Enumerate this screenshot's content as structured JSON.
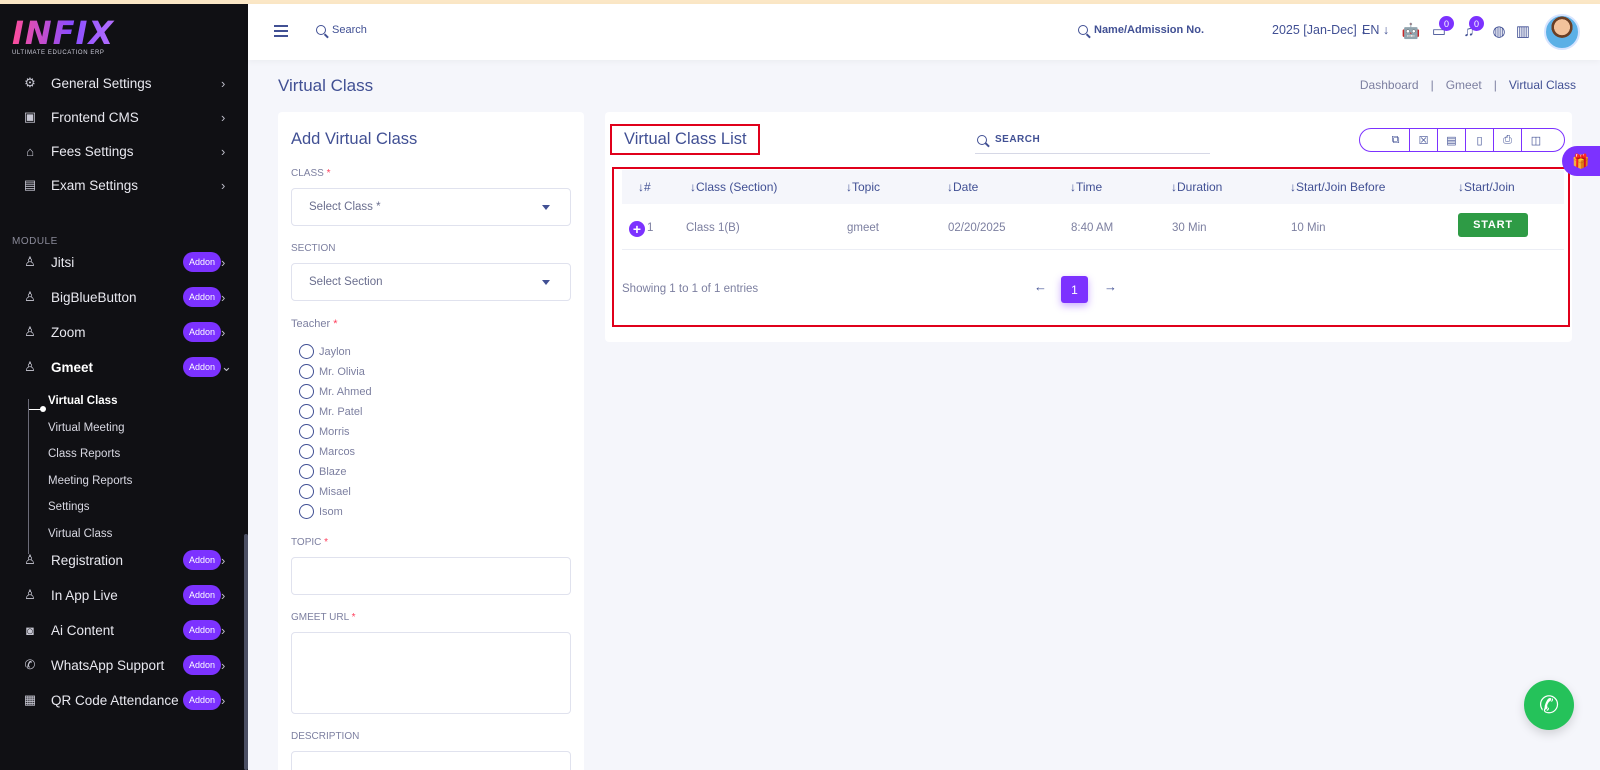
{
  "logo": {
    "text": "INFIX",
    "subtitle": "ULTIMATE EDUCATION ERP"
  },
  "sidebar": {
    "top_items": [
      {
        "label": "General Settings",
        "icon": "gears-icon"
      },
      {
        "label": "Frontend CMS",
        "icon": "desktop-icon"
      },
      {
        "label": "Fees Settings",
        "icon": "bank-icon"
      },
      {
        "label": "Exam Settings",
        "icon": "book-icon"
      }
    ],
    "module_heading": "MODULE",
    "modules": [
      {
        "label": "Jitsi",
        "badge": "Addon"
      },
      {
        "label": "BigBlueButton",
        "badge": "Addon"
      },
      {
        "label": "Zoom",
        "badge": "Addon"
      },
      {
        "label": "Gmeet",
        "badge": "Addon"
      }
    ],
    "gmeet_sub": [
      "Virtual Class",
      "Virtual Meeting",
      "Class Reports",
      "Meeting Reports",
      "Settings",
      "Virtual Class"
    ],
    "bottom_modules": [
      {
        "label": "Registration",
        "badge": "Addon"
      },
      {
        "label": "In App Live",
        "badge": "Addon"
      },
      {
        "label": "Ai Content",
        "badge": "Addon"
      },
      {
        "label": "WhatsApp Support",
        "badge": "Addon"
      },
      {
        "label": "QR Code Attendance",
        "badge": "Addon"
      }
    ]
  },
  "header": {
    "search": "Search",
    "name_search": "Name/Admission No.",
    "year": "2025 [Jan-Dec]",
    "lang": "EN",
    "chat_count": "0",
    "notif_count": "0"
  },
  "page": {
    "title": "Virtual Class",
    "breadcrumb": [
      "Dashboard",
      "Gmeet",
      "Virtual Class"
    ]
  },
  "form": {
    "title": "Add Virtual Class",
    "class_label": "CLASS",
    "class_placeholder": "Select Class *",
    "section_label": "SECTION",
    "section_placeholder": "Select Section",
    "teacher_label": "Teacher",
    "teachers": [
      "Jaylon",
      "Mr. Olivia",
      "Mr. Ahmed",
      "Mr. Patel",
      "Morris",
      "Marcos",
      "Blaze",
      "Misael",
      "Isom"
    ],
    "topic_label": "TOPIC",
    "url_label": "GMEET URL",
    "description_label": "DESCRIPTION",
    "required_mark": "*"
  },
  "list": {
    "title": "Virtual Class List",
    "search_placeholder": "SEARCH",
    "columns": [
      "#",
      "Class (Section)",
      "Topic",
      "Date",
      "Time",
      "Duration",
      "Start/Join Before",
      "Start/Join"
    ],
    "rows": [
      {
        "no": "1",
        "class": "Class 1(B)",
        "topic": "gmeet",
        "date": "02/20/2025",
        "time": "8:40 AM",
        "duration": "30 Min",
        "before": "10 Min",
        "action": "START"
      }
    ],
    "showing": "Showing 1 to 1 of 1 entries",
    "page": "1"
  },
  "colors": {
    "accent": "#7c32ff",
    "start": "#2e9b45",
    "highlight": "#e0001b",
    "whatsapp": "#25c25a"
  }
}
